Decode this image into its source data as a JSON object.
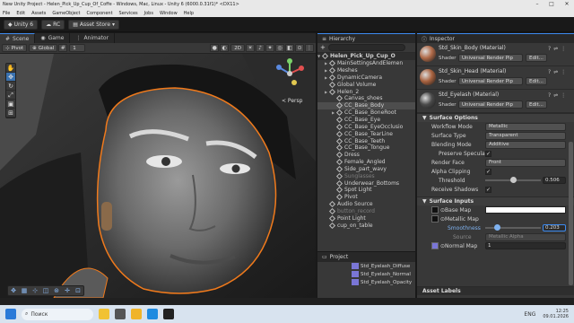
{
  "titlebar": {
    "title": "New Unity Project - Helen_Pick_Up_Cup_Of_Coffe - Windows, Mac, Linux - Unity 6 (6000.0.31f1)* <DX11>"
  },
  "menubar": {
    "items": [
      "File",
      "Edit",
      "Assets",
      "GameObject",
      "Component",
      "Services",
      "Jobs",
      "Window",
      "Help"
    ]
  },
  "toolbar": {
    "account": "Unity 6",
    "rc": "RC",
    "asset_store": "Asset Store"
  },
  "scene_tabs": [
    "Scene",
    "Game",
    "Animator"
  ],
  "scene_toolbar": {
    "pivot": "Pivot",
    "global": "Global",
    "snap_value": "1",
    "mode_2d": "2D"
  },
  "viewport": {
    "persp_label": "< Persp"
  },
  "hierarchy": {
    "title": "Hierarchy",
    "root": "Helen_Pick_Up_Cup_O",
    "items": [
      {
        "label": "MainSettingsAndElemen",
        "state": "normal",
        "indent": 1,
        "arrow": true
      },
      {
        "label": "Meshes",
        "state": "normal",
        "indent": 1,
        "arrow": true
      },
      {
        "label": "DynamicCamera",
        "state": "normal",
        "indent": 1,
        "arrow": true
      },
      {
        "label": "Global Volume",
        "state": "normal",
        "indent": 1,
        "arrow": false
      },
      {
        "label": "Helen_2",
        "state": "normal",
        "indent": 1,
        "arrow": true
      },
      {
        "label": "Canvas_shoes",
        "state": "normal",
        "indent": 2,
        "arrow": false
      },
      {
        "label": "CC_Base_Body",
        "state": "selected",
        "indent": 2,
        "arrow": false
      },
      {
        "label": "CC_Base_BoneRoot",
        "state": "normal",
        "indent": 2,
        "arrow": true
      },
      {
        "label": "CC_Base_Eye",
        "state": "normal",
        "indent": 2,
        "arrow": false
      },
      {
        "label": "CC_Base_EyeOcclusio",
        "state": "normal",
        "indent": 2,
        "arrow": false
      },
      {
        "label": "CC_Base_TearLine",
        "state": "normal",
        "indent": 2,
        "arrow": false
      },
      {
        "label": "CC_Base_Teeth",
        "state": "normal",
        "indent": 2,
        "arrow": false
      },
      {
        "label": "CC_Base_Tongue",
        "state": "normal",
        "indent": 2,
        "arrow": false
      },
      {
        "label": "Dress",
        "state": "normal",
        "indent": 2,
        "arrow": false
      },
      {
        "label": "Female_Angled",
        "state": "normal",
        "indent": 2,
        "arrow": false
      },
      {
        "label": "Side_part_wavy",
        "state": "normal",
        "indent": 2,
        "arrow": false
      },
      {
        "label": "Sunglasses",
        "state": "dim",
        "indent": 2,
        "arrow": false
      },
      {
        "label": "Underwear_Bottoms",
        "state": "normal",
        "indent": 2,
        "arrow": false
      },
      {
        "label": "Spot Light",
        "state": "normal",
        "indent": 2,
        "arrow": false
      },
      {
        "label": "Pivot",
        "state": "normal",
        "indent": 2,
        "arrow": false
      },
      {
        "label": "Audio Source",
        "state": "normal",
        "indent": 1,
        "arrow": false
      },
      {
        "label": "button_record",
        "state": "dim",
        "indent": 1,
        "arrow": false
      },
      {
        "label": "Point Light",
        "state": "normal",
        "indent": 1,
        "arrow": false
      },
      {
        "label": "cup_on_table",
        "state": "normal",
        "indent": 1,
        "arrow": false
      }
    ]
  },
  "project": {
    "title": "Project",
    "items": [
      "Std_Eyelash_Diffuse",
      "Std_Eyelash_Normal",
      "Std_Eyelash_Opacity"
    ]
  },
  "inspector": {
    "title": "Inspector",
    "materials": [
      {
        "name": "Std_Skin_Body (Material)",
        "shader_label": "Shader",
        "shader": "Universal Render Pip",
        "edit": "Edit...",
        "color": "#b06a48"
      },
      {
        "name": "Std_Skin_Head (Material)",
        "shader_label": "Shader",
        "shader": "Universal Render Pip",
        "edit": "Edit...",
        "color": "#a8623f"
      },
      {
        "name": "Std_Eyelash (Material)",
        "shader_label": "Shader",
        "shader": "Universal Render Pip",
        "edit": "Edit...",
        "color": "#4a4a4a"
      }
    ],
    "surface_options": {
      "title": "Surface Options",
      "workflow_mode": {
        "label": "Workflow Mode",
        "value": "Metallic"
      },
      "surface_type": {
        "label": "Surface Type",
        "value": "Transparent"
      },
      "blending_mode": {
        "label": "Blending Mode",
        "value": "Additive"
      },
      "preserve_specular": {
        "label": "Preserve Specular",
        "checked": true
      },
      "render_face": {
        "label": "Render Face",
        "value": "Front"
      },
      "alpha_clipping": {
        "label": "Alpha Clipping",
        "checked": true
      },
      "threshold": {
        "label": "Threshold",
        "value": "0.506",
        "fraction": 0.506
      },
      "receive_shadows": {
        "label": "Receive Shadows",
        "checked": true
      }
    },
    "surface_inputs": {
      "title": "Surface Inputs",
      "base_map": {
        "label": "Base Map"
      },
      "metallic_map": {
        "label": "Metallic Map"
      },
      "smoothness": {
        "label": "Smoothness",
        "value": "0.203",
        "fraction": 0.203
      },
      "source": {
        "label": "Source",
        "value": "Metallic Alpha"
      },
      "normal_map": {
        "label": "Normal Map",
        "value": "1"
      }
    },
    "asset_labels": "Asset Labels"
  },
  "taskbar": {
    "search": "Поиск",
    "lang": "ENG",
    "time": "12:25",
    "date": "09.01.2026"
  },
  "colors": {
    "accent": "#3c8af0",
    "outline": "#f07a1c",
    "panel": "#383838",
    "dark": "#191919"
  }
}
